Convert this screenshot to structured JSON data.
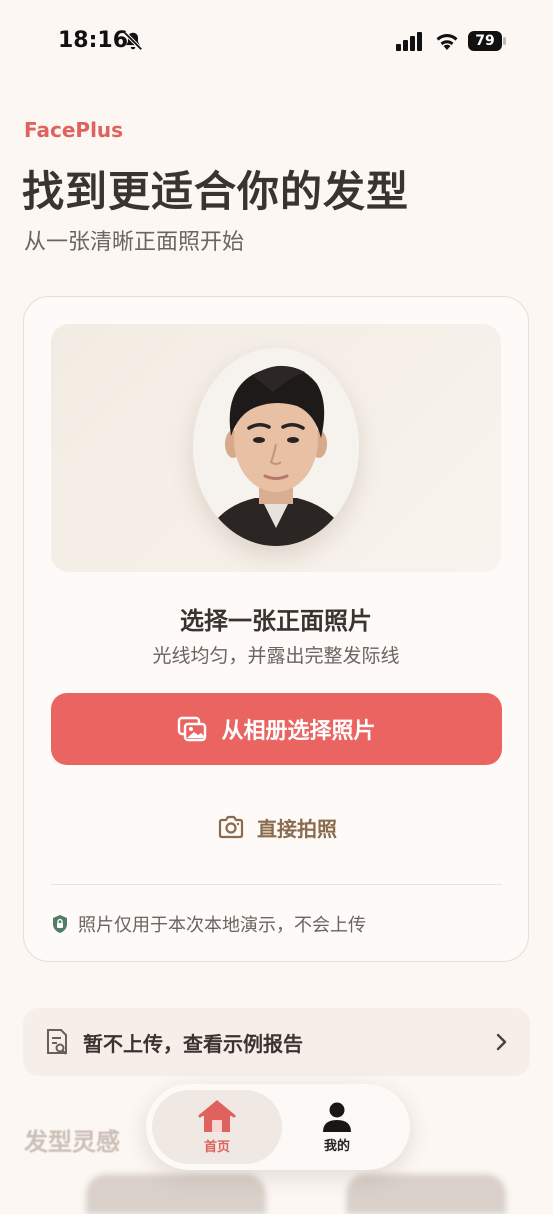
{
  "status_bar": {
    "time": "18:16",
    "battery": "79"
  },
  "header": {
    "brand": "FacePlus",
    "title": "找到更适合你的发型",
    "subtitle": "从一张清晰正面照开始"
  },
  "upload_card": {
    "title": "选择一张正面照片",
    "subtitle": "光线均匀，并露出完整发际线",
    "primary_button": "从相册选择照片",
    "secondary_button": "直接拍照",
    "privacy_note": "照片仅用于本次本地演示，不会上传"
  },
  "sample_report": {
    "label": "暂不上传，查看示例报告"
  },
  "section": {
    "title": "发型灵感"
  },
  "tabbar": {
    "home": "首页",
    "me": "我的"
  },
  "colors": {
    "accent": "#ea6462",
    "brand": "#e0625f",
    "camera": "#8a6b4e",
    "shield": "#4f7d66"
  },
  "icons": [
    "bell-slash-icon",
    "signal-icon",
    "wifi-icon",
    "battery-icon",
    "gallery-icon",
    "camera-icon",
    "shield-icon",
    "report-icon",
    "chevron-right-icon",
    "home-icon",
    "person-icon"
  ]
}
